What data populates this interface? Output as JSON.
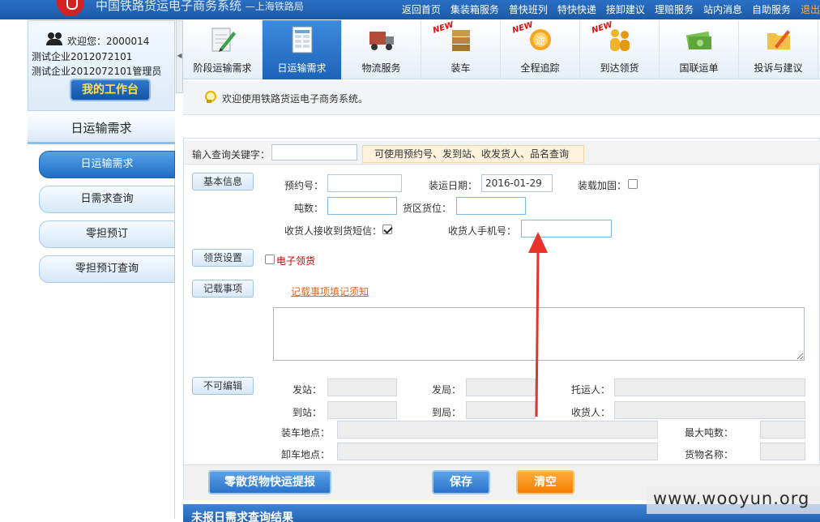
{
  "header": {
    "system_title": "中国铁路货运电子商务系统",
    "system_subtitle": "—上海铁路局",
    "nav": [
      "返回首页",
      "集装箱服务",
      "普快班列",
      "特快快递",
      "接卸建议",
      "理赔服务",
      "站内消息",
      "自助服务",
      "退出"
    ]
  },
  "user": {
    "welcome": "欢迎您：2000014",
    "company": "测试企业2012072101",
    "admin": "测试企业2012072101管理员",
    "workbench_label": "我的工作台"
  },
  "sidebar": {
    "title": "日运输需求",
    "items": [
      {
        "label": "日运输需求",
        "active": true
      },
      {
        "label": "日需求查询",
        "active": false
      },
      {
        "label": "零担预订",
        "active": false
      },
      {
        "label": "零担预订查询",
        "active": false
      }
    ]
  },
  "tabs": [
    {
      "label": "阶段运输需求",
      "icon": "document-pen-icon",
      "new": false,
      "active": false
    },
    {
      "label": "日运输需求",
      "icon": "spreadsheet-icon",
      "new": false,
      "active": true
    },
    {
      "label": "物流服务",
      "icon": "truck-icon",
      "new": false,
      "active": false
    },
    {
      "label": "装车",
      "icon": "loading-boxes-icon",
      "new": true,
      "active": false
    },
    {
      "label": "全程追踪",
      "icon": "tracking-icon",
      "new": true,
      "active": false
    },
    {
      "label": "到达领货",
      "icon": "people-icon",
      "new": true,
      "active": false
    },
    {
      "label": "国联运单",
      "icon": "money-bills-icon",
      "new": false,
      "active": false
    },
    {
      "label": "投诉与建议",
      "icon": "folder-pencil-icon",
      "new": false,
      "active": false
    }
  ],
  "new_badge": "NEW",
  "welcome_message": "欢迎使用铁路货运电子商务系统。",
  "form": {
    "keyword_label": "输入查询关键字：",
    "keyword_value": "",
    "keyword_hint": "可使用预约号、发到站、收发货人、品名查询",
    "basic_info_tag": "基本信息",
    "booking_no_label": "预约号：",
    "booking_no_value": "",
    "ship_date_label": "装运日期：",
    "ship_date_value": "2016-01-29",
    "reinforce_label": "装载加固：",
    "reinforce_checked": false,
    "tonnage_label": "吨数：",
    "tonnage_value": "",
    "slot_label": "货区货位：",
    "slot_value": "",
    "sms_label": "收货人接收到货短信：",
    "sms_checked": true,
    "phone_label": "收货人手机号：",
    "phone_value": "",
    "pickup_tag": "领货设置",
    "epickup_label": "电子领货",
    "epickup_checked": false,
    "notes_tag": "记载事项",
    "notes_link": "记载事项填记须知",
    "notes_value": "",
    "readonly_tag": "不可编辑",
    "from_station_label": "发站：",
    "from_bureau_label": "发局：",
    "shipper_label": "托运人：",
    "to_station_label": "到站：",
    "to_bureau_label": "到局：",
    "consignee_label": "收货人：",
    "load_place_label": "装车地点：",
    "max_ton_label": "最大吨数：",
    "unload_place_label": "卸车地点：",
    "cargo_name_label": "货物名称："
  },
  "buttons": {
    "express": "零散货物快运提报",
    "save": "保存",
    "clear": "清空"
  },
  "bottom_strip": "未报日需求查询结果",
  "watermark": "www.wooyun.org",
  "colors": {
    "primary_blue": "#1d63b8",
    "accent_orange": "#f27d00",
    "arrow_red": "#e8322a"
  }
}
